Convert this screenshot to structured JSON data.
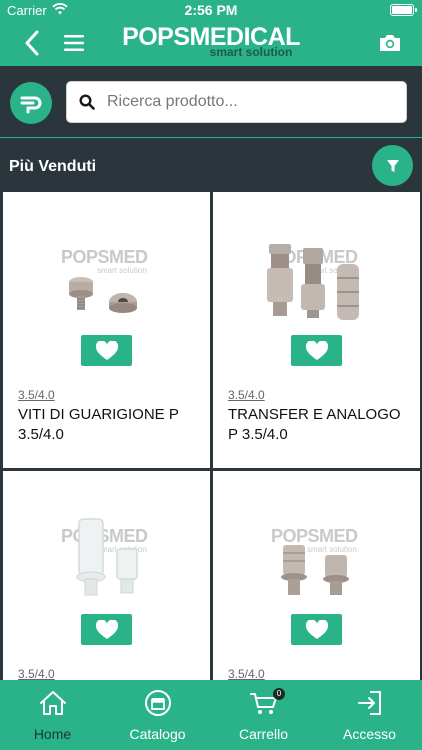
{
  "status_bar": {
    "carrier": "Carrier",
    "time": "2:56 PM"
  },
  "header": {
    "brand": "POPSMEDICAL",
    "tagline": "smart solution"
  },
  "search": {
    "placeholder": "Ricerca prodotto..."
  },
  "section": {
    "title": "Più Venduti"
  },
  "watermark": {
    "brand": "POPSMED",
    "tagline": "smart solution"
  },
  "products": [
    {
      "code": "3.5/4.0",
      "name": "VITI DI GUARIGIONE P 3.5/4.0"
    },
    {
      "code": "3.5/4.0",
      "name": "TRANSFER E ANALOGO P 3.5/4.0"
    },
    {
      "code": "3.5/4.0",
      "name": ""
    },
    {
      "code": "3.5/4.0",
      "name": ""
    }
  ],
  "tabs": [
    {
      "label": "Home",
      "icon": "home-icon",
      "active": true
    },
    {
      "label": "Catalogo",
      "icon": "store-icon",
      "active": false
    },
    {
      "label": "Carrello",
      "icon": "cart-icon",
      "active": false,
      "badge": "0"
    },
    {
      "label": "Accesso",
      "icon": "login-icon",
      "active": false
    }
  ],
  "colors": {
    "accent": "#2ab388",
    "background": "#2b353c",
    "card": "#ffffff"
  }
}
